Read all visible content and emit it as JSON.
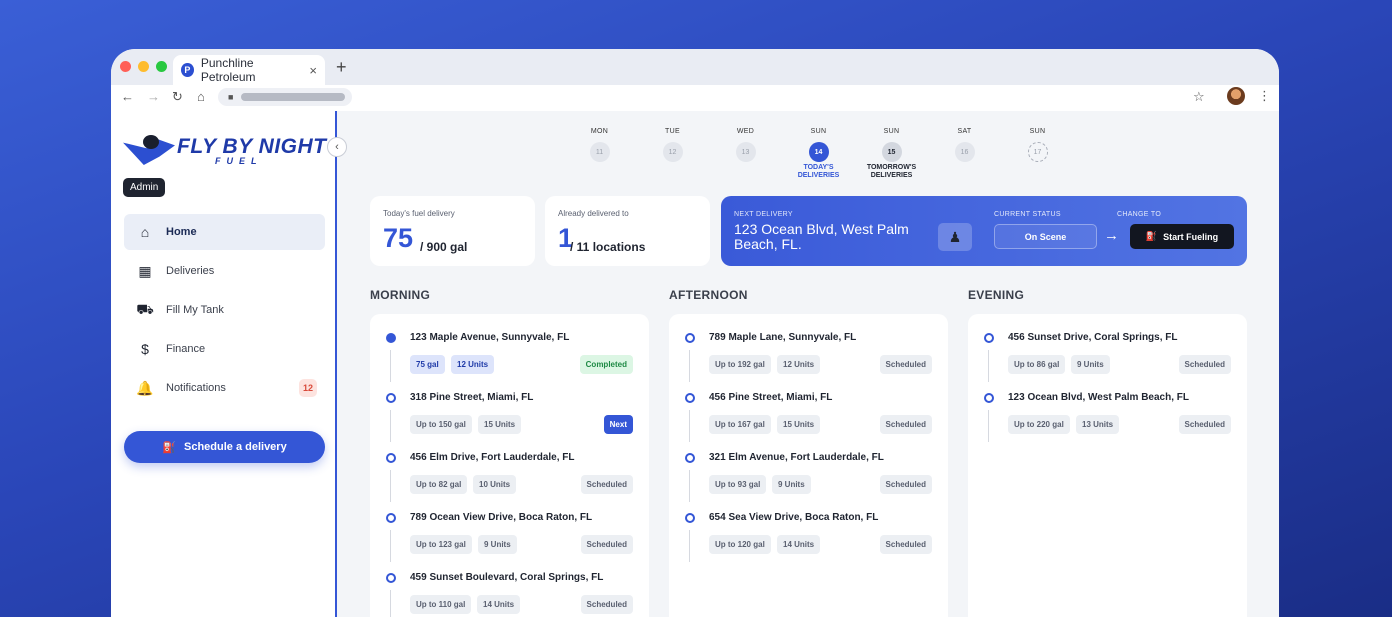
{
  "browser": {
    "tab_title": "Punchline Petroleum",
    "tab_favicon": "P",
    "close": "×",
    "new_tab": "+",
    "traffic_lights": [
      "#ff5f57",
      "#febc2e",
      "#28c840"
    ]
  },
  "sidebar": {
    "logo_main": "FLY BY NIGHT",
    "logo_sub": "FUEL",
    "collapse_glyph": "‹",
    "role_badge": "Admin",
    "items": [
      {
        "label": "Home",
        "icon": "home-icon",
        "active": true
      },
      {
        "label": "Deliveries",
        "icon": "calendar-icon"
      },
      {
        "label": "Fill My Tank",
        "icon": "truck-icon"
      },
      {
        "label": "Finance",
        "icon": "dollar-icon"
      },
      {
        "label": "Notifications",
        "icon": "bell-icon",
        "badge": "12"
      }
    ],
    "schedule_label": "Schedule a delivery"
  },
  "calendar": [
    {
      "day": "MON",
      "num": "11",
      "state": "past"
    },
    {
      "day": "TUE",
      "num": "12",
      "state": "past"
    },
    {
      "day": "WED",
      "num": "13",
      "state": "past"
    },
    {
      "day": "SUN",
      "num": "14",
      "state": "today",
      "caption": "TODAY'S DELIVERIES"
    },
    {
      "day": "SUN",
      "num": "15",
      "state": "tomorrow",
      "caption": "TOMORROW'S DELIVERIES"
    },
    {
      "day": "SAT",
      "num": "16",
      "state": "past"
    },
    {
      "day": "SUN",
      "num": "17",
      "state": "future"
    }
  ],
  "stats": {
    "fuel_label": "Today's fuel delivery",
    "fuel_value": "75",
    "fuel_unit": "/ 900 gal",
    "delivered_label": "Already delivered to",
    "delivered_value": "1",
    "delivered_unit": "/ 11 locations"
  },
  "next_delivery": {
    "label": "NEXT DELIVERY",
    "address": "123 Ocean Blvd, West Palm Beach, FL.",
    "status_label": "CURRENT STATUS",
    "status": "On Scene",
    "change_label": "CHANGE TO",
    "arrow": "→",
    "action": "Start Fueling"
  },
  "sections": [
    {
      "title": "MORNING",
      "entries": [
        {
          "address": "123 Maple Avenue, Sunnyvale, FL",
          "gal": "75 gal",
          "units": "12 Units",
          "status": "Completed",
          "kind": "completed"
        },
        {
          "address": "318 Pine Street, Miami, FL",
          "gal": "Up to 150 gal",
          "units": "15 Units",
          "status": "Next",
          "kind": "next"
        },
        {
          "address": "456 Elm Drive, Fort Lauderdale, FL",
          "gal": "Up to 82 gal",
          "units": "10 Units",
          "status": "Scheduled",
          "kind": "scheduled"
        },
        {
          "address": "789 Ocean View Drive, Boca Raton, FL",
          "gal": "Up to 123 gal",
          "units": "9 Units",
          "status": "Scheduled",
          "kind": "scheduled"
        },
        {
          "address": "459 Sunset Boulevard, Coral Springs, FL",
          "gal": "Up to 110 gal",
          "units": "14 Units",
          "status": "Scheduled",
          "kind": "scheduled"
        }
      ]
    },
    {
      "title": "AFTERNOON",
      "entries": [
        {
          "address": "789 Maple Lane, Sunnyvale, FL",
          "gal": "Up to 192 gal",
          "units": "12 Units",
          "status": "Scheduled",
          "kind": "scheduled"
        },
        {
          "address": "456 Pine Street, Miami, FL",
          "gal": "Up to 167 gal",
          "units": "15 Units",
          "status": "Scheduled",
          "kind": "scheduled"
        },
        {
          "address": "321 Elm Avenue, Fort Lauderdale, FL",
          "gal": "Up to 93 gal",
          "units": "9 Units",
          "status": "Scheduled",
          "kind": "scheduled"
        },
        {
          "address": "654 Sea View Drive, Boca Raton, FL",
          "gal": "Up to 120 gal",
          "units": "14 Units",
          "status": "Scheduled",
          "kind": "scheduled"
        }
      ]
    },
    {
      "title": "EVENING",
      "entries": [
        {
          "address": "456 Sunset Drive, Coral Springs, FL",
          "gal": "Up to 86 gal",
          "units": "9 Units",
          "status": "Scheduled",
          "kind": "scheduled"
        },
        {
          "address": "123 Ocean Blvd, West Palm Beach, FL",
          "gal": "Up to 220 gal",
          "units": "13 Units",
          "status": "Scheduled",
          "kind": "scheduled"
        }
      ]
    }
  ]
}
